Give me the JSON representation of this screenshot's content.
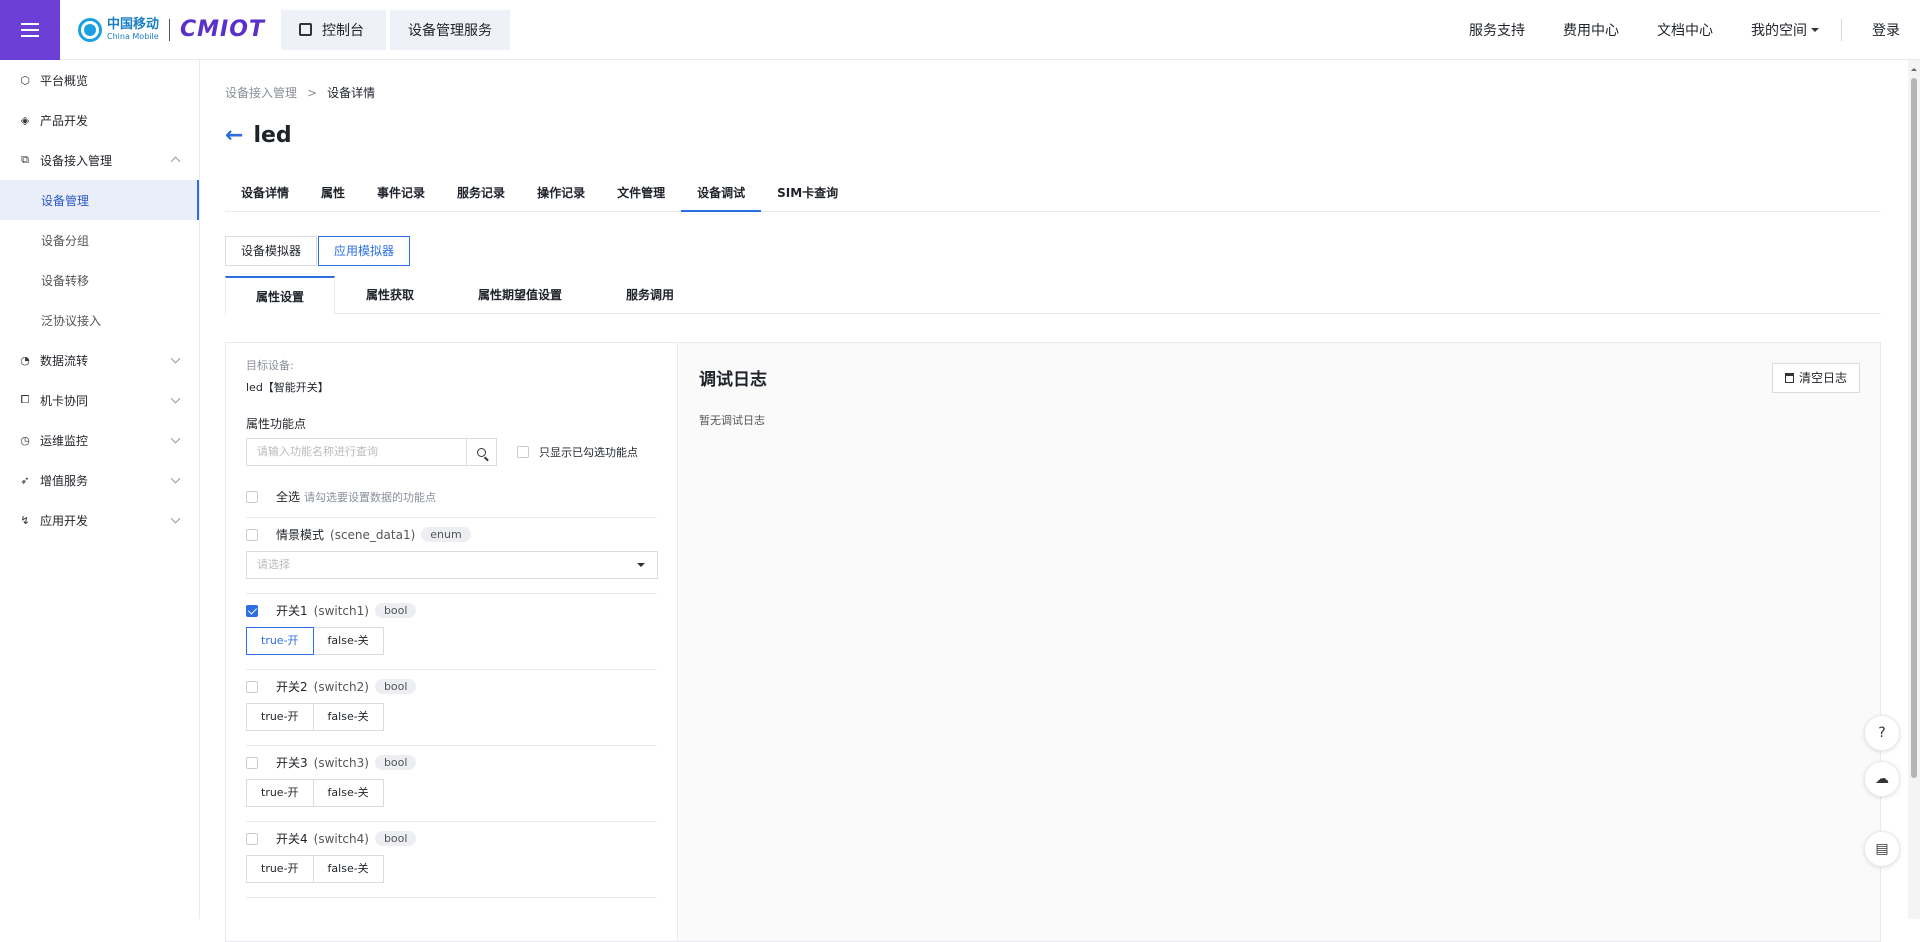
{
  "header": {
    "logo_cn": "中国移动",
    "logo_en": "China Mobile",
    "logo_brand": "CMIOT",
    "console_label": "控制台",
    "service_label": "设备管理服务",
    "links": [
      "服务支持",
      "费用中心",
      "文档中心"
    ],
    "my_space": "我的空间",
    "login": "登录"
  },
  "sidebar": {
    "items": [
      {
        "label": "平台概览",
        "icon": "cube-icon"
      },
      {
        "label": "产品开发",
        "icon": "box-icon"
      },
      {
        "label": "设备接入管理",
        "icon": "device-icon"
      },
      {
        "label": "数据流转",
        "icon": "flow-icon"
      },
      {
        "label": "机卡协同",
        "icon": "link-icon"
      },
      {
        "label": "运维监控",
        "icon": "monitor-icon"
      },
      {
        "label": "增值服务",
        "icon": "send-icon"
      },
      {
        "label": "应用开发",
        "icon": "app-icon"
      }
    ],
    "sub_items": [
      "设备管理",
      "设备分组",
      "设备转移",
      "泛协议接入"
    ]
  },
  "breadcrumb": {
    "parent": "设备接入管理",
    "separator": ">",
    "current": "设备详情"
  },
  "page_title": "led",
  "tabs": [
    "设备详情",
    "属性",
    "事件记录",
    "服务记录",
    "操作记录",
    "文件管理",
    "设备调试",
    "SIM卡查询"
  ],
  "simulator": {
    "device_sim": "设备模拟器",
    "app_sim": "应用模拟器"
  },
  "subtabs": [
    "属性设置",
    "属性获取",
    "属性期望值设置",
    "服务调用"
  ],
  "left": {
    "target_label": "目标设备:",
    "target_value": "led【智能开关】",
    "feature_label": "属性功能点",
    "search_placeholder": "请输入功能名称进行查询",
    "only_selected": "只显示已勾选功能点",
    "select_all": "全选",
    "select_all_hint": "请勾选要设置数据的功能点",
    "scene": {
      "name": "情景模式",
      "id": "(scene_data1)",
      "type": "enum",
      "placeholder": "请选择"
    },
    "switches": [
      {
        "name": "开关1",
        "id": "(switch1)",
        "type": "bool",
        "checked": true,
        "true_label": "true-开",
        "false_label": "false-关"
      },
      {
        "name": "开关2",
        "id": "(switch2)",
        "type": "bool",
        "checked": false,
        "true_label": "true-开",
        "false_label": "false-关"
      },
      {
        "name": "开关3",
        "id": "(switch3)",
        "type": "bool",
        "checked": false,
        "true_label": "true-开",
        "false_label": "false-关"
      },
      {
        "name": "开关4",
        "id": "(switch4)",
        "type": "bool",
        "checked": false,
        "true_label": "true-开",
        "false_label": "false-关"
      }
    ]
  },
  "log": {
    "title": "调试日志",
    "empty": "暂无调试日志",
    "clear": "清空日志"
  },
  "colors": {
    "accent": "#2b6fe3",
    "brand": "#6b3fd6"
  }
}
